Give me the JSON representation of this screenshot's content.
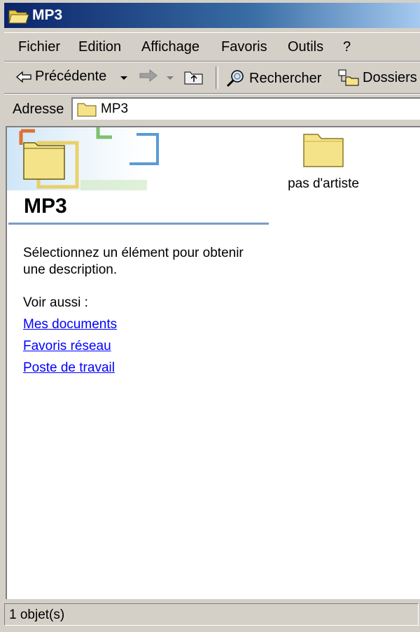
{
  "window": {
    "title": "MP3"
  },
  "menubar": {
    "items": [
      {
        "label": "Fichier"
      },
      {
        "label": "Edition"
      },
      {
        "label": "Affichage"
      },
      {
        "label": "Favoris"
      },
      {
        "label": "Outils"
      },
      {
        "label": "?"
      }
    ]
  },
  "toolbar": {
    "back_label": "Précédente",
    "search_label": "Rechercher",
    "folders_label": "Dossiers"
  },
  "address": {
    "label": "Adresse",
    "value": "MP3"
  },
  "panel": {
    "title": "MP3",
    "description": "Sélectionnez un élément pour obtenir une description.",
    "see_also": "Voir aussi :",
    "links": [
      "Mes documents",
      "Favoris réseau",
      "Poste de travail"
    ]
  },
  "items": [
    {
      "name": "pas d'artiste"
    }
  ],
  "status": {
    "text": "1 objet(s)"
  },
  "colors": {
    "titlebar": "#0a246a",
    "face": "#d4d0c8",
    "link": "#0000ff",
    "folder": "#f5e38a"
  }
}
